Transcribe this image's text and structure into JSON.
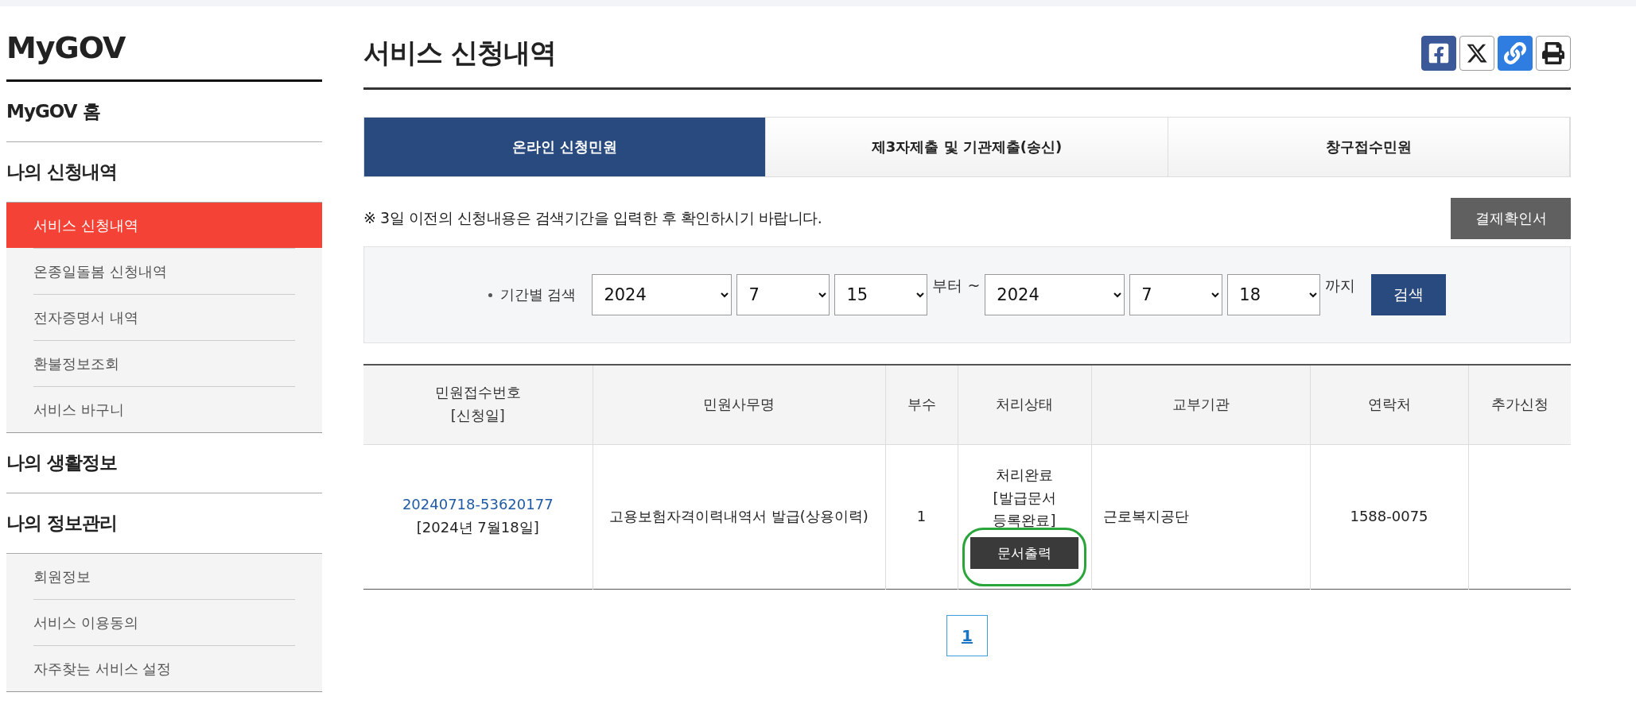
{
  "sidebar": {
    "title": "MyGOV",
    "sections": [
      {
        "label": "MyGOV 홈"
      },
      {
        "label": "나의 신청내역",
        "children": [
          {
            "label": "서비스 신청내역",
            "selected": true
          },
          {
            "label": "온종일돌봄 신청내역",
            "selected": false
          },
          {
            "label": "전자증명서 내역",
            "selected": false
          },
          {
            "label": "환불정보조회",
            "selected": false
          },
          {
            "label": "서비스 바구니",
            "selected": false
          }
        ]
      },
      {
        "label": "나의 생활정보"
      },
      {
        "label": "나의 정보관리",
        "children": [
          {
            "label": "회원정보",
            "selected": false
          },
          {
            "label": "서비스 이용동의",
            "selected": false
          },
          {
            "label": "자주찾는 서비스 설정",
            "selected": false
          }
        ]
      }
    ]
  },
  "page_title": "서비스 신청내역",
  "share_buttons": [
    {
      "kind": "facebook"
    },
    {
      "kind": "x"
    },
    {
      "kind": "link"
    },
    {
      "kind": "print"
    }
  ],
  "tabs": [
    {
      "label": "온라인 신청민원",
      "selected": true
    },
    {
      "label": "제3자제출 및 기관제출(송신)",
      "selected": false
    },
    {
      "label": "창구접수민원",
      "selected": false
    }
  ],
  "notice": "※ 3일 이전의 신청내용은 검색기간을 입력한 후 확인하시기 바랍니다.",
  "receipt_button": "결제확인서",
  "search": {
    "label": "기간별 검색",
    "from": {
      "year": "2024",
      "month": "7",
      "day": "15"
    },
    "from_suffix": "부터 ~",
    "to": {
      "year": "2024",
      "month": "7",
      "day": "18"
    },
    "to_suffix": "까지",
    "button": "검색"
  },
  "table": {
    "columns": [
      {
        "lines": [
          "민원접수번호",
          "[신청일]"
        ]
      },
      {
        "lines": [
          "민원사무명"
        ]
      },
      {
        "lines": [
          "부수"
        ]
      },
      {
        "lines": [
          "처리상태"
        ]
      },
      {
        "lines": [
          "교부기관"
        ]
      },
      {
        "lines": [
          "연락처"
        ]
      },
      {
        "lines": [
          "추가신청"
        ]
      }
    ],
    "rows": [
      {
        "number": "20240718-53620177",
        "date": "[2024년 7월18일]",
        "service": "고용보험자격이력내역서 발급(상용이력)",
        "copies": "1",
        "status_lines": [
          "처리완료",
          "[발급문서",
          "등록완료]"
        ],
        "print_button": "문서출력",
        "highlighted": true,
        "agency": "근로복지공단",
        "contact": "1588-0075"
      }
    ]
  },
  "pagination": [
    {
      "label": "1",
      "selected": true
    }
  ]
}
